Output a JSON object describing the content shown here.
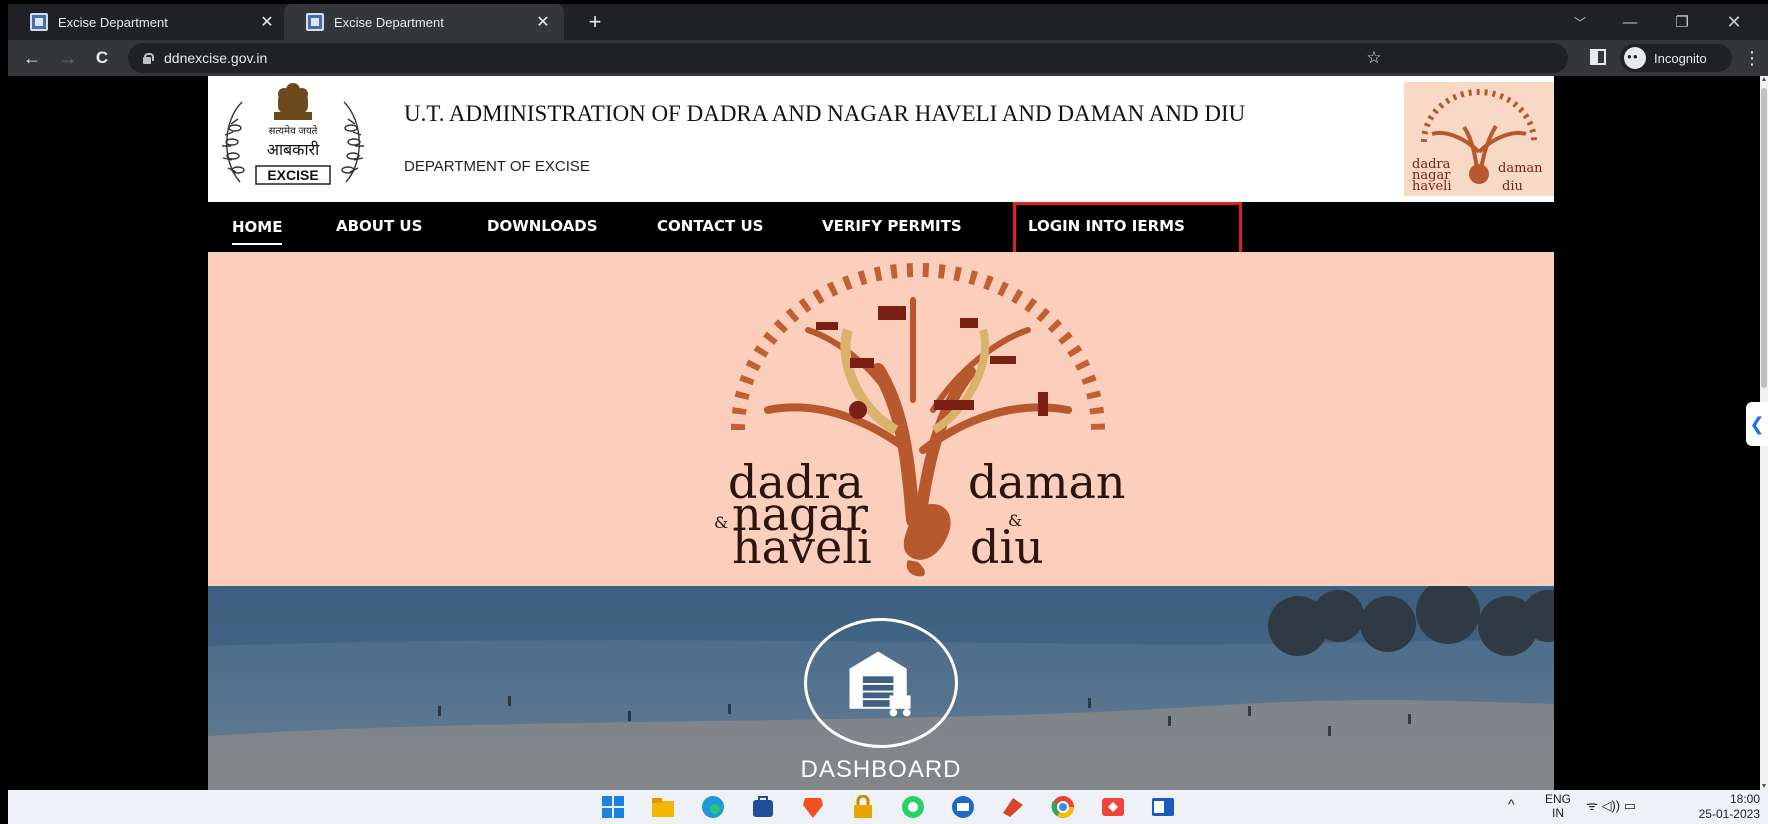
{
  "browser": {
    "tabs": [
      {
        "title": "Excise Department",
        "close": "✕"
      },
      {
        "title": "Excise Department",
        "close": "✕"
      }
    ],
    "new_tab": "+",
    "window_controls": {
      "chevron": "﹀",
      "minimize": "—",
      "restore": "❐",
      "close": "✕"
    },
    "nav": {
      "back": "←",
      "forward": "→",
      "reload": "C"
    },
    "url": "ddnexcise.gov.in",
    "bookmark": "☆",
    "incognito_label": "Incognito",
    "menu": "⋮"
  },
  "site": {
    "header": {
      "title": "U.T. ADMINISTRATION OF DADRA AND NAGAR HAVELI AND DAMAN AND DIU",
      "subtitle": "DEPARTMENT OF EXCISE",
      "emblem_text": [
        "सत्यमेव जयते",
        "आबकारी",
        "EXCISE"
      ],
      "corner_logo_text": {
        "left": [
          "dadra",
          "nagar",
          "haveli"
        ],
        "right": [
          "daman",
          "diu"
        ],
        "amp": "&"
      }
    },
    "nav": [
      {
        "label": "HOME"
      },
      {
        "label": "ABOUT US"
      },
      {
        "label": "DOWNLOADS"
      },
      {
        "label": "CONTACT US"
      },
      {
        "label": "VERIFY PERMITS"
      },
      {
        "label": "LOGIN INTO IERMS"
      }
    ],
    "banner": {
      "left": [
        "dadra",
        "nagar",
        "haveli"
      ],
      "right": [
        "daman",
        "diu"
      ],
      "amp": "&"
    },
    "dashboard_label": "DASHBOARD"
  },
  "side_tab": "❮",
  "taskbar": {
    "icons": [
      "windows-start-icon",
      "file-explorer-icon",
      "edge-icon",
      "store-icon",
      "brave-icon",
      "lock-app-icon",
      "whatsapp-icon",
      "remote-desktop-icon",
      "app-icon",
      "chrome-icon",
      "anydesk-icon",
      "word-icon"
    ],
    "tray_chevron": "^",
    "lang": [
      "ENG",
      "IN"
    ],
    "tray": "ᯤ ◁)) ▭",
    "time": "18:00",
    "date": "25-01-2023"
  },
  "colors": {
    "banner_bg": "#fbcfbb",
    "tree_brown": "#b8582e",
    "tree_dark": "#7a1f14",
    "highlight": "#e02020"
  }
}
